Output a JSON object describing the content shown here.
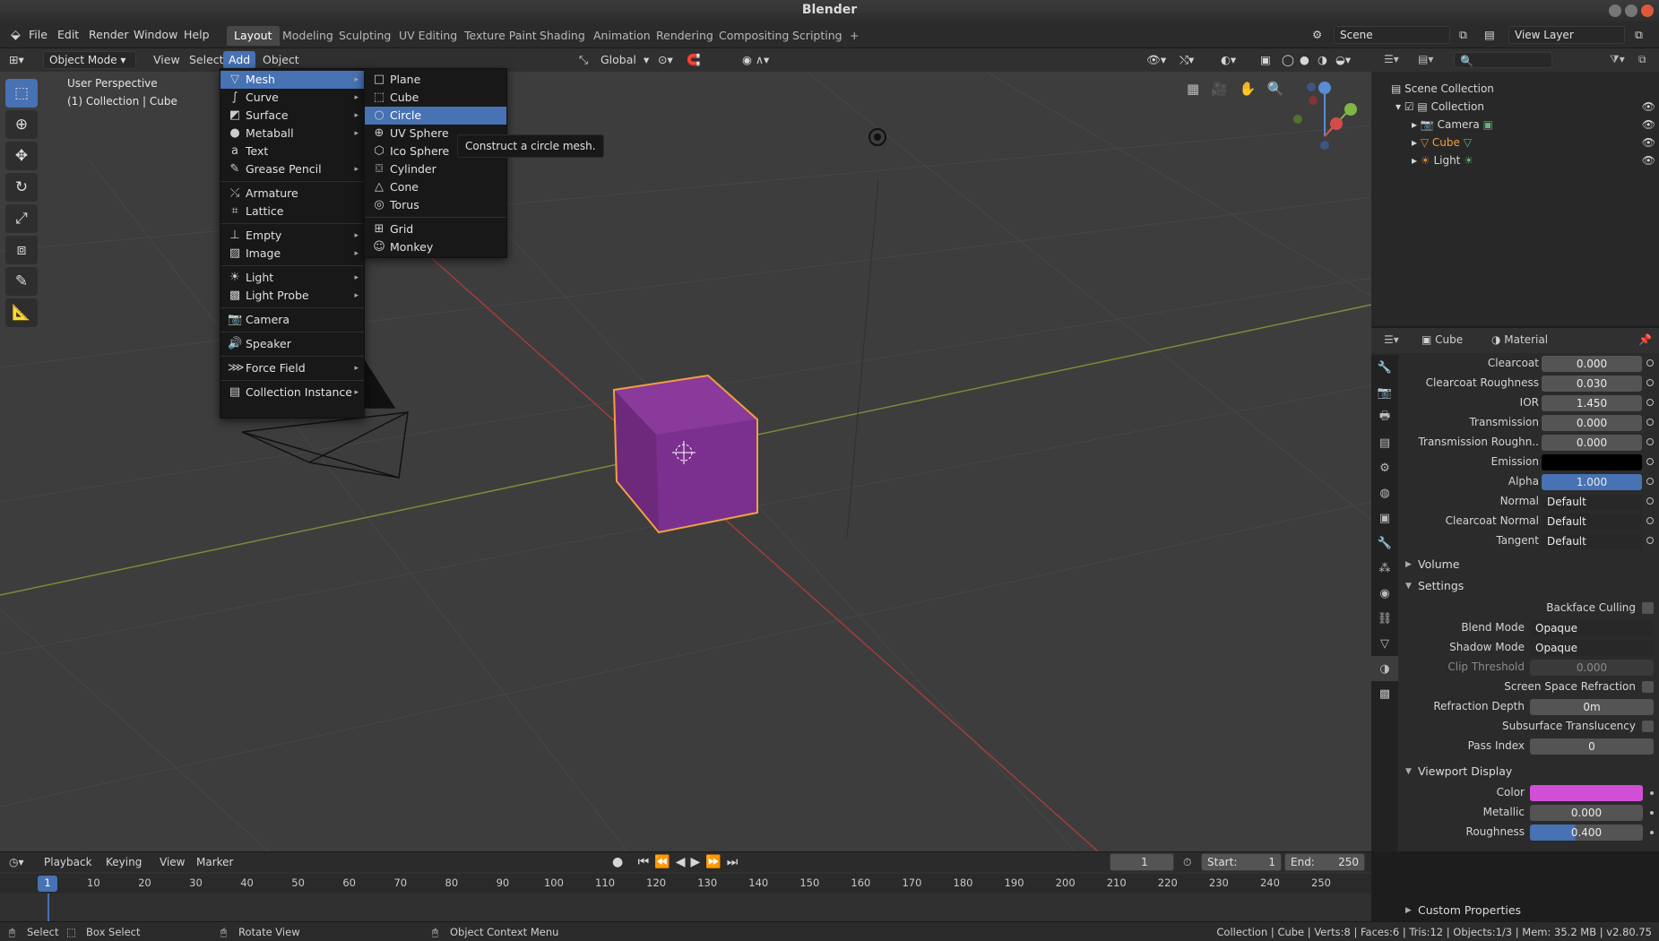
{
  "window": {
    "title": "Blender"
  },
  "topmenu": [
    "File",
    "Edit",
    "Render",
    "Window",
    "Help"
  ],
  "workspaces": [
    "Layout",
    "Modeling",
    "Sculpting",
    "UV Editing",
    "Texture Paint",
    "Shading",
    "Animation",
    "Rendering",
    "Compositing",
    "Scripting"
  ],
  "scene": {
    "name": "Scene",
    "view_layer": "View Layer"
  },
  "viewport_header": {
    "mode": "Object Mode",
    "menus": [
      "View",
      "Select",
      "Add",
      "Object"
    ],
    "orientation": "Global"
  },
  "viewport": {
    "perspective": "User Perspective",
    "context": "(1) Collection | Cube"
  },
  "add_menu": {
    "items": [
      {
        "label": "Mesh",
        "icon": "mesh-icon"
      },
      {
        "label": "Curve",
        "icon": "curve-icon"
      },
      {
        "label": "Surface",
        "icon": "surface-icon"
      },
      {
        "label": "Metaball",
        "icon": "metaball-icon"
      },
      {
        "label": "Text",
        "icon": "text-icon"
      },
      {
        "label": "Grease Pencil",
        "icon": "grease-pencil-icon"
      },
      {
        "label": "Armature",
        "icon": "armature-icon"
      },
      {
        "label": "Lattice",
        "icon": "lattice-icon"
      },
      {
        "label": "Empty",
        "icon": "empty-icon"
      },
      {
        "label": "Image",
        "icon": "image-icon"
      },
      {
        "label": "Light",
        "icon": "light-icon"
      },
      {
        "label": "Light Probe",
        "icon": "light-probe-icon"
      },
      {
        "label": "Camera",
        "icon": "camera-icon"
      },
      {
        "label": "Speaker",
        "icon": "speaker-icon"
      },
      {
        "label": "Force Field",
        "icon": "force-field-icon"
      },
      {
        "label": "Collection Instance",
        "icon": "collection-instance-icon"
      }
    ]
  },
  "mesh_submenu": {
    "items": [
      "Plane",
      "Cube",
      "Circle",
      "UV Sphere",
      "Ico Sphere",
      "Cylinder",
      "Cone",
      "Torus",
      "Grid",
      "Monkey"
    ]
  },
  "tooltip": "Construct a circle mesh.",
  "outliner": {
    "root": "Scene Collection",
    "collection": "Collection",
    "objects": [
      "Camera",
      "Cube",
      "Light"
    ]
  },
  "properties": {
    "object": "Cube",
    "material": "Material",
    "rows": [
      {
        "label": "Clearcoat",
        "value": "0.000"
      },
      {
        "label": "Clearcoat Roughness",
        "value": "0.030"
      },
      {
        "label": "IOR",
        "value": "1.450"
      },
      {
        "label": "Transmission",
        "value": "0.000"
      },
      {
        "label": "Transmission Roughn..",
        "value": "0.000"
      },
      {
        "label": "Emission",
        "value": ""
      },
      {
        "label": "Alpha",
        "value": "1.000"
      },
      {
        "label": "Normal",
        "value": "Default"
      },
      {
        "label": "Clearcoat Normal",
        "value": "Default"
      },
      {
        "label": "Tangent",
        "value": "Default"
      }
    ],
    "volume": "Volume",
    "settings": "Settings",
    "settings_rows": [
      {
        "label": "Backface Culling",
        "value": ""
      },
      {
        "label": "Blend Mode",
        "value": "Opaque"
      },
      {
        "label": "Shadow Mode",
        "value": "Opaque"
      },
      {
        "label": "Clip Threshold",
        "value": "0.000"
      },
      {
        "label": "Screen Space Refraction",
        "value": ""
      },
      {
        "label": "Refraction Depth",
        "value": "0m"
      },
      {
        "label": "Subsurface Translucency",
        "value": ""
      },
      {
        "label": "Pass Index",
        "value": "0"
      }
    ],
    "viewport_display": "Viewport Display",
    "vd_rows": [
      {
        "label": "Color",
        "value": ""
      },
      {
        "label": "Metallic",
        "value": "0.000"
      },
      {
        "label": "Roughness",
        "value": "0.400"
      }
    ],
    "custom_properties": "Custom Properties"
  },
  "timeline": {
    "menus": [
      "Playback",
      "Keying",
      "View",
      "Marker"
    ],
    "current_frame": "1",
    "start_label": "Start:",
    "start": "1",
    "end_label": "End:",
    "end": "250",
    "ticks": [
      "1",
      "10",
      "20",
      "30",
      "40",
      "50",
      "60",
      "70",
      "80",
      "90",
      "100",
      "110",
      "120",
      "130",
      "140",
      "150",
      "160",
      "170",
      "180",
      "190",
      "200",
      "210",
      "220",
      "230",
      "240",
      "250"
    ]
  },
  "statusbar": {
    "select": "Select",
    "box_select": "Box Select",
    "rotate_view": "Rotate View",
    "context_menu": "Object Context Menu",
    "stats": "Collection | Cube | Verts:8 | Faces:6 | Tris:12 | Objects:1/3 | Mem: 35.2 MB | v2.80.75"
  },
  "colors": {
    "accent": "#4772b3",
    "cube": "#7a2a8a",
    "selection": "#f0a040",
    "viewport_color": "#d14fd6"
  }
}
